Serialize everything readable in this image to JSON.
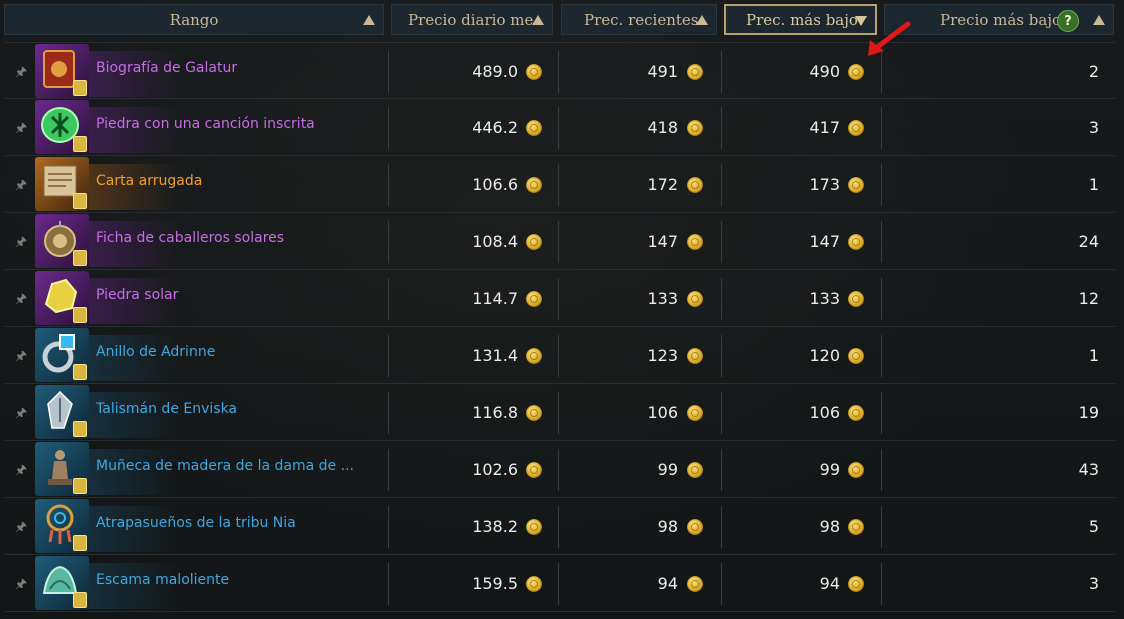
{
  "columns": {
    "rank": "Rango",
    "daily_avg": "Precio diario me",
    "recent": "Prec. recientes",
    "lowest_sorted": "Prec. más bajo",
    "lowest": "Precio más bajo"
  },
  "help_icon": "?",
  "accent_colors": {
    "purple": "#c86ce8",
    "orange": "#f0a030",
    "blue": "#3fa8e0",
    "header_text": "#c8b896",
    "active_border": "#b9a16a",
    "annotation_arrow": "#e01818"
  },
  "rows": [
    {
      "name": "Biografía de Galatur",
      "grade": "purple",
      "icon": "book-icon",
      "daily": "489.0",
      "recent": "491",
      "low": "490",
      "qty": "2"
    },
    {
      "name": "Piedra con una canción inscrita",
      "grade": "purple",
      "icon": "rune-stone-icon",
      "daily": "446.2",
      "recent": "418",
      "low": "417",
      "qty": "3"
    },
    {
      "name": "Carta arrugada",
      "grade": "orange",
      "icon": "letter-icon",
      "daily": "106.6",
      "recent": "172",
      "low": "173",
      "qty": "1"
    },
    {
      "name": "Ficha de caballeros solares",
      "grade": "purple",
      "icon": "medallion-icon",
      "daily": "108.4",
      "recent": "147",
      "low": "147",
      "qty": "24"
    },
    {
      "name": "Piedra solar",
      "grade": "purple",
      "icon": "sun-stone-icon",
      "daily": "114.7",
      "recent": "133",
      "low": "133",
      "qty": "12"
    },
    {
      "name": "Anillo de Adrinne",
      "grade": "blue",
      "icon": "ring-icon",
      "daily": "131.4",
      "recent": "123",
      "low": "120",
      "qty": "1"
    },
    {
      "name": "Talismán de Enviska",
      "grade": "blue",
      "icon": "talisman-icon",
      "daily": "116.8",
      "recent": "106",
      "low": "106",
      "qty": "19"
    },
    {
      "name": "Muñeca de madera de la dama de ...",
      "grade": "blue",
      "icon": "statue-icon",
      "daily": "102.6",
      "recent": "99",
      "low": "99",
      "qty": "43"
    },
    {
      "name": "Atrapasueños de la tribu Nia",
      "grade": "blue",
      "icon": "dreamcatcher-icon",
      "daily": "138.2",
      "recent": "98",
      "low": "98",
      "qty": "5"
    },
    {
      "name": "Escama maloliente",
      "grade": "blue",
      "icon": "scale-icon",
      "daily": "159.5",
      "recent": "94",
      "low": "94",
      "qty": "3"
    }
  ]
}
